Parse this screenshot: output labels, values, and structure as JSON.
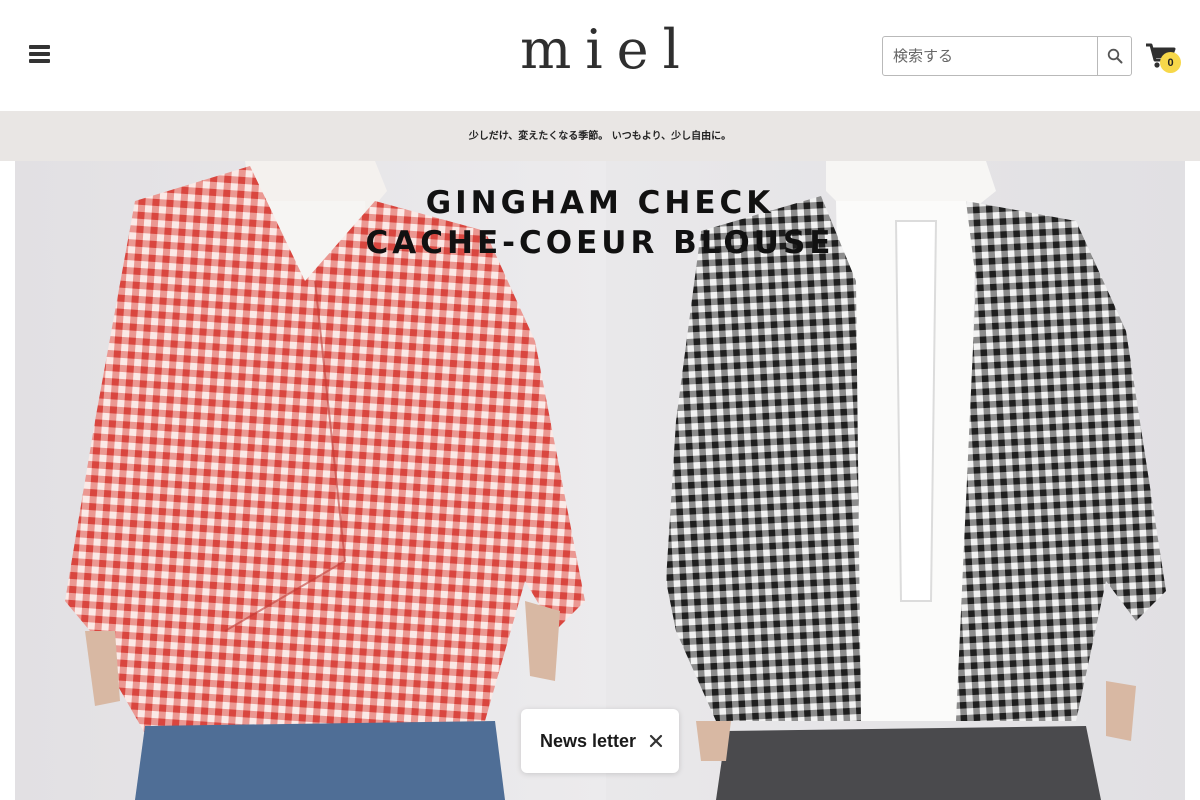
{
  "header": {
    "logo_text": "miel",
    "search": {
      "placeholder": "検索する",
      "value": ""
    },
    "cart": {
      "count": "0"
    },
    "menu_icon": "hamburger-menu-icon",
    "search_icon": "search-icon",
    "cart_icon": "shopping-cart-icon"
  },
  "announcement": {
    "text": "少しだけ、変えたくなる季節。 いつもより、少し自由に。"
  },
  "hero": {
    "title_line1": "GINGHAM CHECK",
    "title_line2": "CACHE-COEUR BLOUSE"
  },
  "newsletter": {
    "label": "News letter",
    "close_icon": "close-icon"
  },
  "colors": {
    "announcement_bg": "#e9e6e4",
    "cart_badge": "#f7d84a",
    "red_gingham": "#d9463f",
    "black_gingham": "#1e1e1e"
  }
}
